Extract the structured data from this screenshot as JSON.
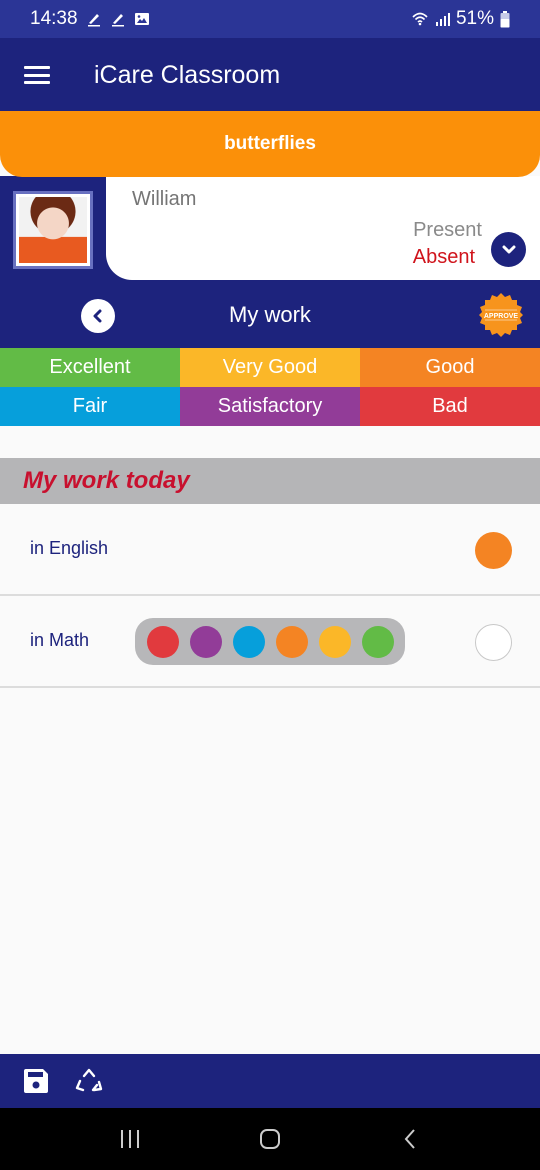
{
  "status_bar": {
    "time": "14:38",
    "left_icons": [
      "pen-icon",
      "pen-icon",
      "image-icon"
    ],
    "battery": "51%"
  },
  "app_bar": {
    "title": "iCare Classroom"
  },
  "class_banner": {
    "name": "butterflies"
  },
  "student": {
    "name": "William",
    "attendance_options": [
      "Present",
      "Absent"
    ],
    "selected_attendance": "Absent"
  },
  "work_bar": {
    "title": "My work",
    "approve_label": "APPROVE"
  },
  "legend": [
    {
      "label": "Excellent",
      "color": "#62bb46"
    },
    {
      "label": "Very Good",
      "color": "#fbb728"
    },
    {
      "label": "Good",
      "color": "#f48423"
    },
    {
      "label": "Fair",
      "color": "#069fdb"
    },
    {
      "label": "Satisfactory",
      "color": "#923c98"
    },
    {
      "label": "Bad",
      "color": "#e13a3e"
    }
  ],
  "section": {
    "title": "My work today"
  },
  "subjects": [
    {
      "label": "in English",
      "grade": "Good",
      "grade_color": "#f48423",
      "picker_open": false
    },
    {
      "label": "in Math",
      "grade": null,
      "grade_color": null,
      "picker_open": true,
      "picker_colors": [
        "#e13a3e",
        "#923c98",
        "#069fdb",
        "#f48423",
        "#fbb728",
        "#62bb46"
      ],
      "picker_labels": [
        "Bad",
        "Satisfactory",
        "Fair",
        "Good",
        "Very Good",
        "Excellent"
      ]
    }
  ],
  "bottom_bar": {
    "tools": [
      "save-icon",
      "recycle-icon"
    ]
  },
  "colors": {
    "primary": "#1d237d",
    "accent": "#fb9009",
    "absent": "#d0141c",
    "section_title": "#c8102e"
  }
}
